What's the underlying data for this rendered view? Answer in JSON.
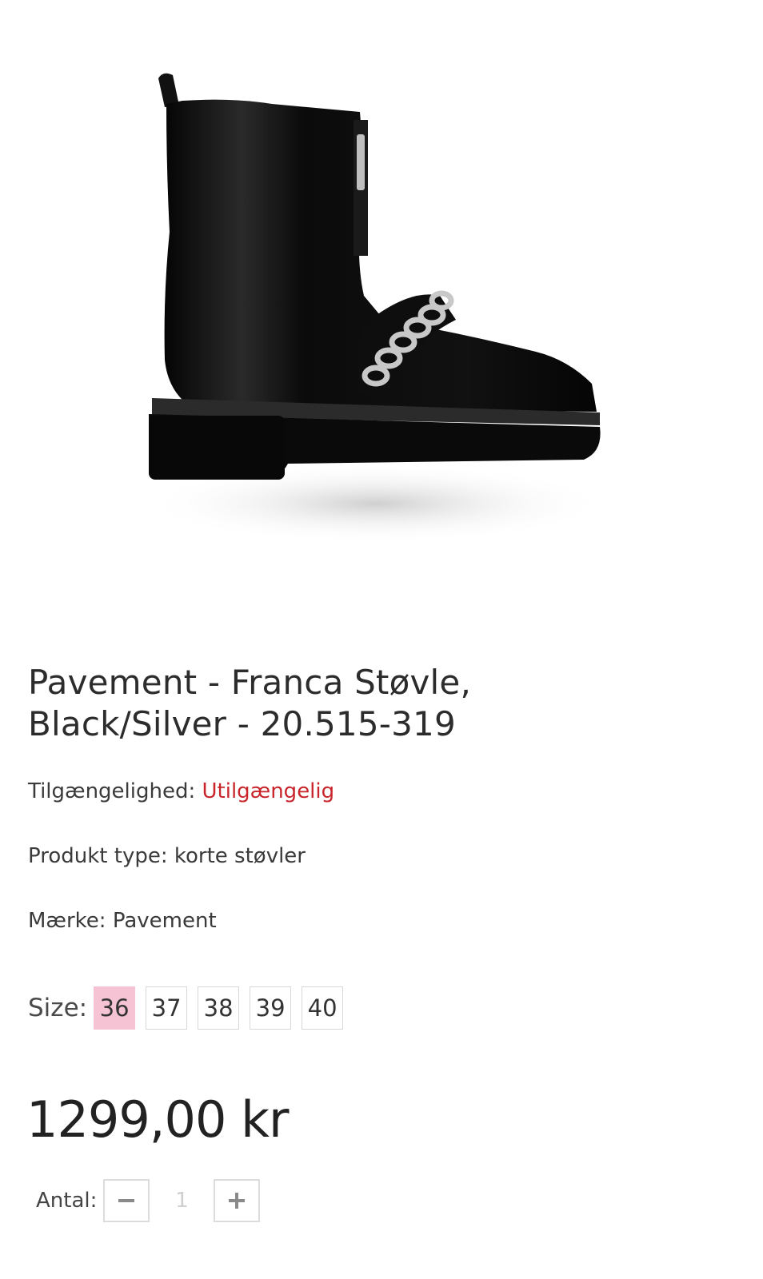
{
  "product": {
    "image_icon": "black-leather-chain-boot-image",
    "title_line1": "Pavement - Franca Støvle,",
    "title_line2": "Black/Silver - 20.515-319",
    "availability_label": "Tilgængelighed:",
    "availability_value": "Utilgængelig",
    "type_label": "Produkt type:",
    "type_value": "korte støvler",
    "brand_label": "Mærke:",
    "brand_value": "Pavement"
  },
  "size": {
    "label": "Size:",
    "options": [
      "36",
      "37",
      "38",
      "39",
      "40"
    ],
    "selected": "36"
  },
  "price": "1299,00 kr",
  "quantity": {
    "label": "Antal:",
    "value": "1",
    "minus_icon": "minus-icon",
    "plus_icon": "plus-icon"
  },
  "colors": {
    "unavailable": "#c8242a",
    "selected_size_bg": "#f5c3d4"
  }
}
